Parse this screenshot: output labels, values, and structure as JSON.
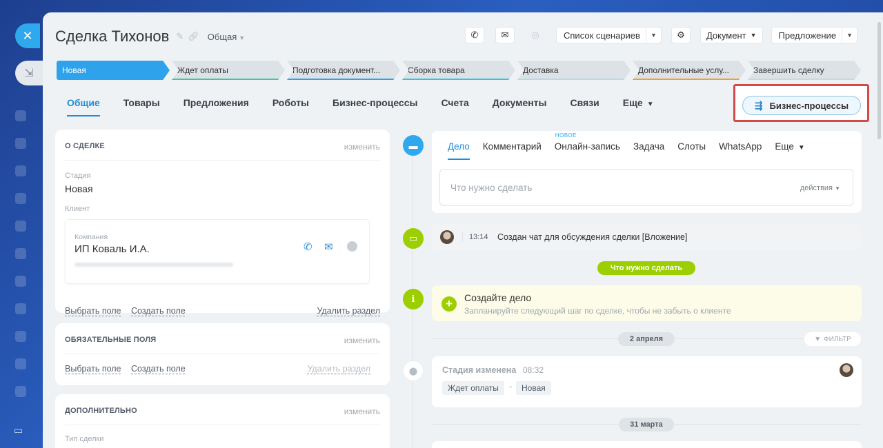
{
  "deal": {
    "title": "Сделка Тихонов",
    "category": "Общая"
  },
  "toolbar": {
    "scenarios_label": "Список сценариев",
    "document_label": "Документ",
    "proposal_label": "Предложение"
  },
  "stages": [
    {
      "label": "Новая",
      "color": "#2ea3ec"
    },
    {
      "label": "Ждет оплаты",
      "color": "#3fc7a5"
    },
    {
      "label": "Подготовка документ...",
      "color": "#2ea3ec"
    },
    {
      "label": "Сборка товара",
      "color": "#38c0e0"
    },
    {
      "label": "Доставка",
      "color": "#b3dbe6"
    },
    {
      "label": "Дополнительные услу...",
      "color": "#f0a030"
    },
    {
      "label": "Завершить сделку",
      "color": "#cfd5da"
    }
  ],
  "tabs": [
    {
      "label": "Общие",
      "active": true
    },
    {
      "label": "Товары"
    },
    {
      "label": "Предложения"
    },
    {
      "label": "Роботы"
    },
    {
      "label": "Бизнес-процессы"
    },
    {
      "label": "Счета"
    },
    {
      "label": "Документы"
    },
    {
      "label": "Связи"
    },
    {
      "label": "Еще"
    }
  ],
  "bp_button": "Бизнес-процессы",
  "about": {
    "head": "О СДЕЛКЕ",
    "edit": "изменить",
    "stage_label": "Стадия",
    "stage_value": "Новая",
    "client_label": "Клиент",
    "company_label": "Компания",
    "company_name": "ИП Коваль И.А.",
    "select_field": "Выбрать поле",
    "create_field": "Создать поле",
    "delete_section": "Удалить раздел"
  },
  "required": {
    "head": "ОБЯЗАТЕЛЬНЫЕ ПОЛЯ",
    "edit": "изменить",
    "select_field": "Выбрать поле",
    "create_field": "Создать поле",
    "delete_section": "Удалить раздел"
  },
  "extra": {
    "head": "ДОПОЛНИТЕЛЬНО",
    "edit": "изменить",
    "deal_type_label": "Тип сделки"
  },
  "editor": {
    "tabs": [
      "Дело",
      "Комментарий",
      "Онлайн-запись",
      "Задача",
      "Слоты",
      "WhatsApp",
      "Еще"
    ],
    "new_badge": "НОВОЕ",
    "placeholder": "Что нужно сделать",
    "actions": "действия"
  },
  "timeline": {
    "chat_time": "13:14",
    "chat_text": "Создан чат для обсуждения сделки [Вложение]",
    "todo_badge": "Что нужно сделать",
    "create_title": "Создайте дело",
    "create_sub": "Запланируйте следующий шаг по сделке, чтобы не забыть о клиенте",
    "date1": "2 апреля",
    "filter": "ФИЛЬТР",
    "stage_changed": "Стадия изменена",
    "stage_time": "08:32",
    "stage_from": "Ждет оплаты",
    "stage_to": "Новая",
    "date2": "31 марта"
  }
}
